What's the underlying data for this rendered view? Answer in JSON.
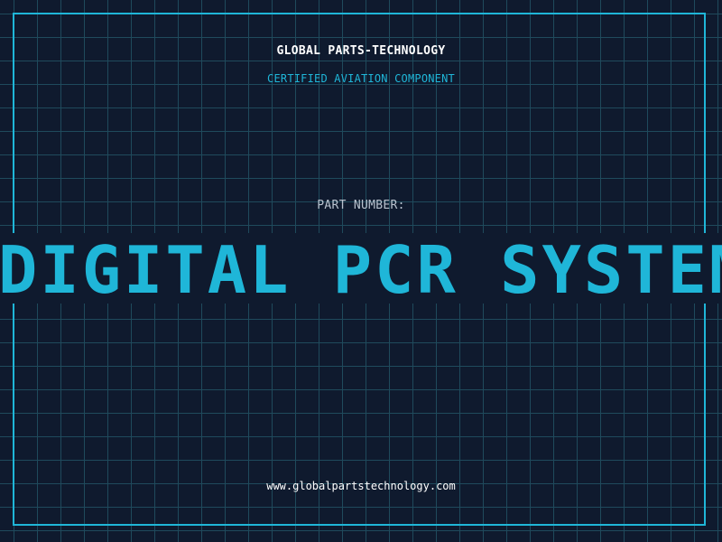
{
  "header": {
    "brand": "GLOBAL PARTS-TECHNOLOGY",
    "subtitle": "CERTIFIED AVIATION COMPONENT"
  },
  "part": {
    "label": "PART NUMBER:",
    "value": "DIGITAL PCR SYSTEM"
  },
  "footer": {
    "website": "www.globalpartstechnology.com"
  },
  "colors": {
    "background": "#0f1a2e",
    "grid": "#1f4a5c",
    "accent": "#1fb6d8",
    "text": "#ffffff",
    "muted": "#b9c3cf"
  }
}
